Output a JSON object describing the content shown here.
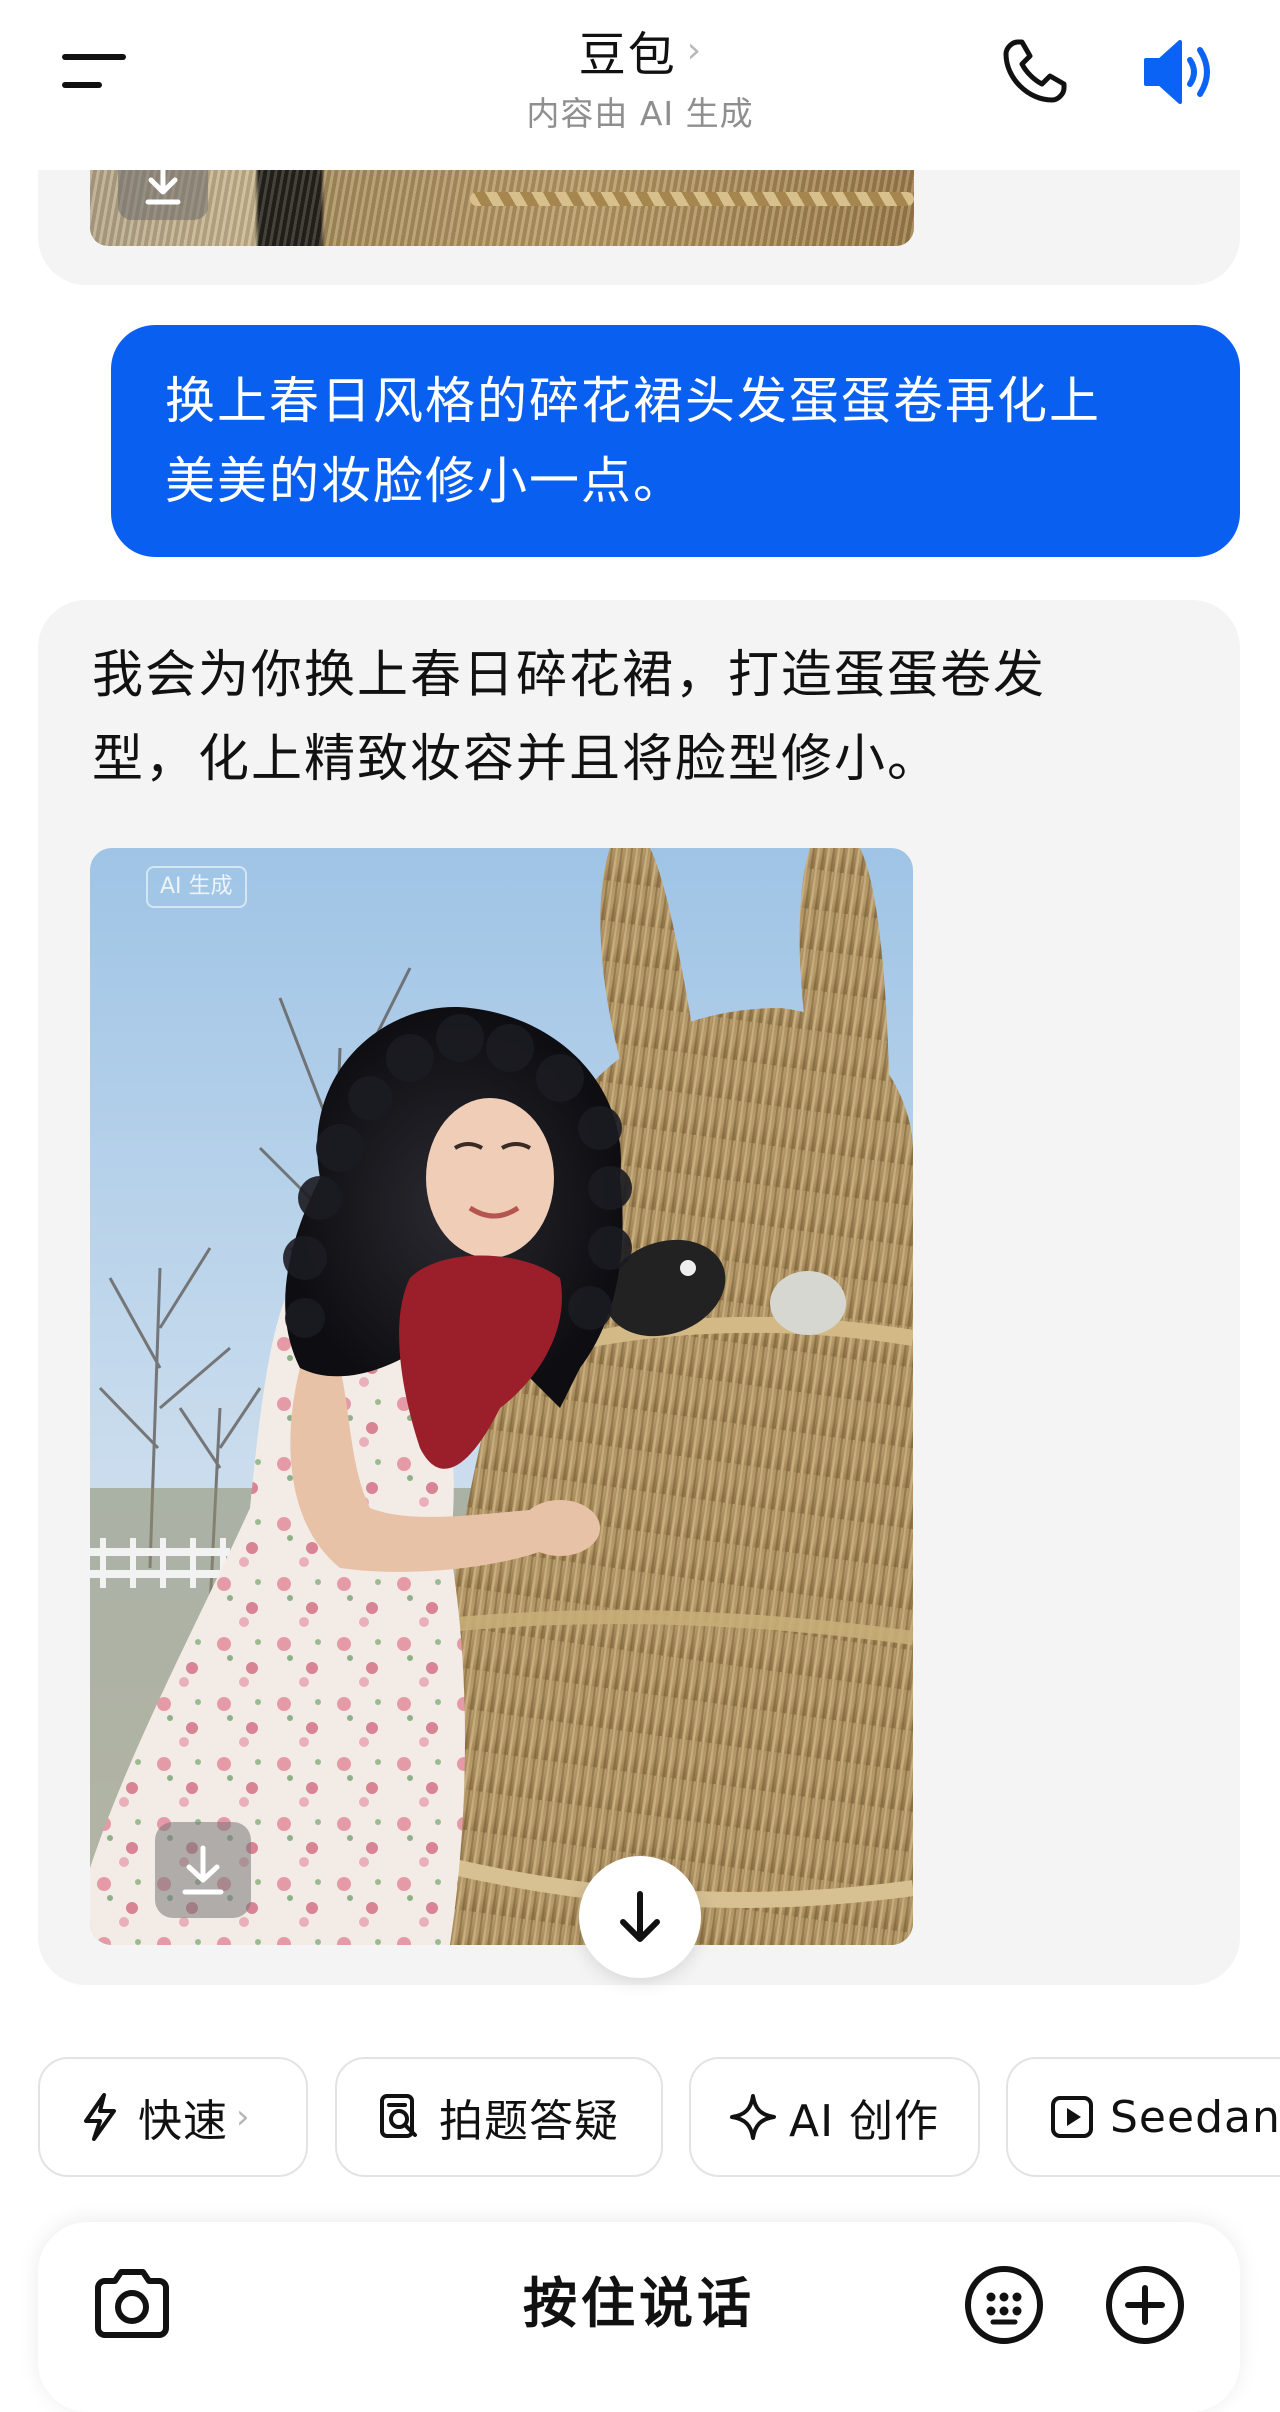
{
  "header": {
    "title": "豆包",
    "title_chevron": "›",
    "subtitle": "内容由 AI 生成"
  },
  "messages": {
    "user_text_line1": "换上春日风格的碎花裙头发蛋蛋卷再化上",
    "user_text_line2": "美美的妆脸修小一点。",
    "ai_text_line1": "我会为你换上春日碎花裙，打造蛋蛋卷发",
    "ai_text_line2": "型，化上精致妆容并且将脸型修小。",
    "image_badge": "AI 生成"
  },
  "chips": [
    {
      "label": "快速",
      "chevron": "›",
      "icon": "lightning-icon"
    },
    {
      "label": "拍题答疑",
      "icon": "photo-question-icon"
    },
    {
      "label": "AI 创作",
      "icon": "sparkle-icon"
    },
    {
      "label": "Seedance",
      "icon": "video-play-icon"
    }
  ],
  "input_bar": {
    "hold_to_talk": "按住说话"
  },
  "colors": {
    "accent": "#0960F0",
    "user_bubble": "#0960F0",
    "card_background": "#F4F4F5",
    "subtitle_gray": "#8F8F8F"
  }
}
